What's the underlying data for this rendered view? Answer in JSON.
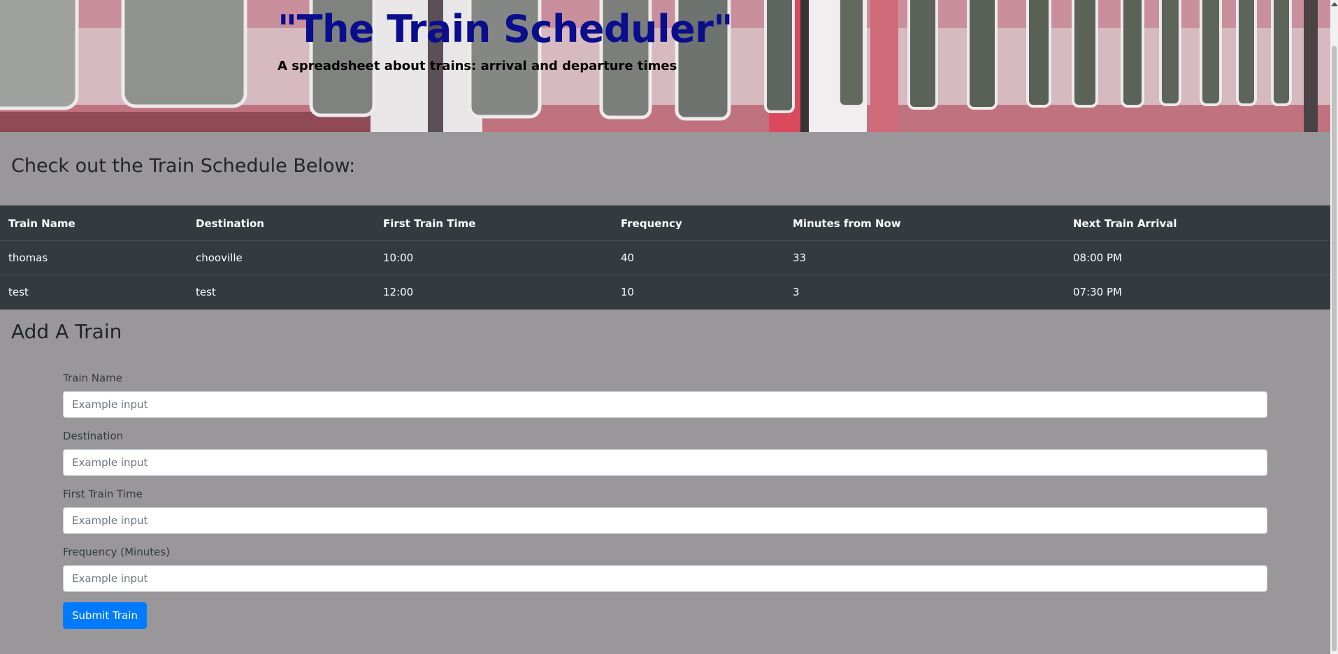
{
  "header": {
    "title": "\"The Train Scheduler\"",
    "subtitle": "A spreadsheet about trains: arrival and departure times"
  },
  "schedule": {
    "heading": "Check out the Train Schedule Below:",
    "columns": [
      "Train Name",
      "Destination",
      "First Train Time",
      "Frequency",
      "Minutes from Now",
      "Next Train Arrival"
    ],
    "rows": [
      [
        "thomas",
        "chooville",
        "10:00",
        "40",
        "33",
        "08:00 PM"
      ],
      [
        "test",
        "test",
        "12:00",
        "10",
        "3",
        "07:30 PM"
      ]
    ]
  },
  "form": {
    "heading": "Add A Train",
    "fields": [
      {
        "label": "Train Name",
        "placeholder": "Example input",
        "value": ""
      },
      {
        "label": "Destination",
        "placeholder": "Example input",
        "value": ""
      },
      {
        "label": "First Train Time",
        "placeholder": "Example input",
        "value": ""
      },
      {
        "label": "Frequency (Minutes)",
        "placeholder": "Example input",
        "value": ""
      }
    ],
    "submit_label": "Submit Train"
  },
  "colors": {
    "page_bg": "#999799",
    "title": "#0a0d8c",
    "table_bg": "#343a40",
    "button": "#007bff"
  },
  "icons": {
    "scroll_up": "scroll-up-arrow-icon"
  }
}
